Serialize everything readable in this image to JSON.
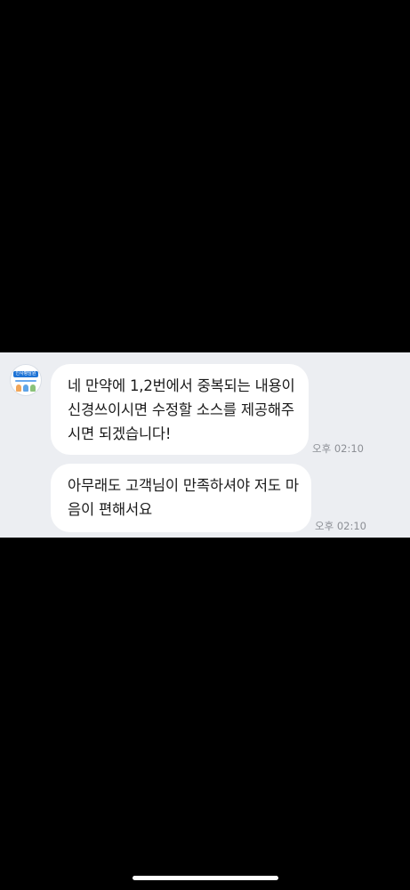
{
  "contact": {
    "avatar_badge_text": "인사평담원",
    "avatar_icon": "profile-avatar-icon"
  },
  "messages": [
    {
      "lines": [
        "네 만약에 1,2번에서 중복되는 내용이",
        "신경쓰이시면 수정할 소스를 제공해주",
        "시면 되겠습니다!"
      ],
      "time": "오후 02:10"
    },
    {
      "lines": [
        "아무래도 고객님이 만족하셔야 저도 마",
        "음이 편해서요"
      ],
      "time": "오후 02:10"
    }
  ],
  "colors": {
    "chat_background": "#eceef2",
    "bubble": "#ffffff",
    "screen_background": "#000000",
    "timestamp_text": "#8c8f95",
    "message_text": "#1a1a1a"
  }
}
